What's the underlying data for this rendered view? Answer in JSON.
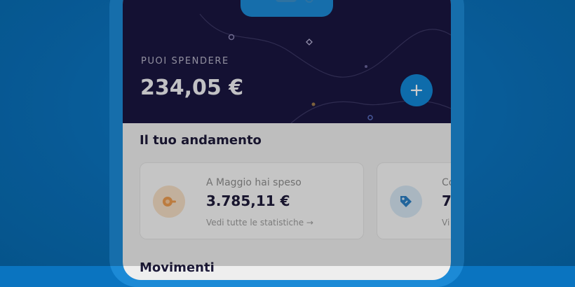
{
  "header": {
    "balance_label": "PUOI SPENDERE",
    "balance_value": "234,05 €",
    "add_button_icon": "plus-icon"
  },
  "performance": {
    "title": "Il tuo andamento",
    "cards": [
      {
        "icon": "coins-icon",
        "label": "A Maggio hai speso",
        "value": "3.785,11 €",
        "link": "Vedi tutte le statistiche →"
      },
      {
        "icon": "tag-icon",
        "label": "Co",
        "value": "7",
        "link": "Vi"
      }
    ]
  },
  "next_section": {
    "title": "Movimenti"
  },
  "colors": {
    "background": "#0a74c0",
    "header": "#1a1640",
    "accent": "#1287d6",
    "orange_icon": "#f3dcc4",
    "blue_icon": "#d4e4f1"
  }
}
